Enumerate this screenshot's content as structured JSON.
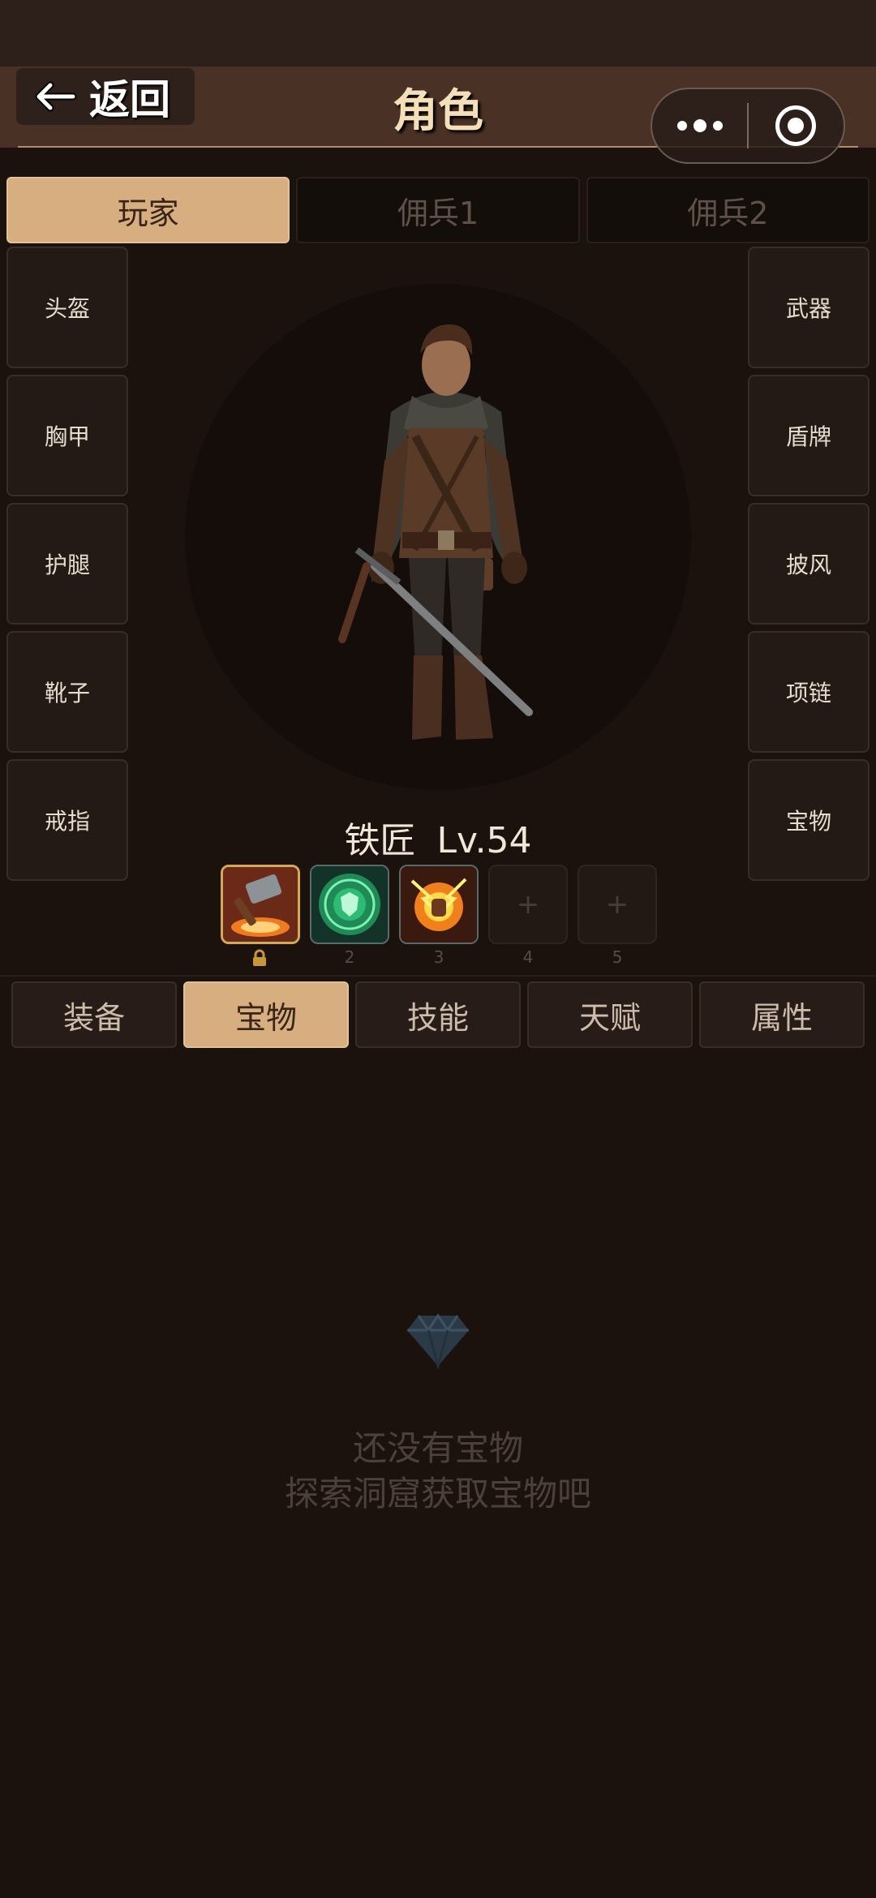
{
  "header": {
    "back_label": "返回",
    "title": "角色",
    "menu_icon": "more-dots-icon",
    "close_icon": "target-circle-icon"
  },
  "character_tabs": [
    {
      "label": "玩家",
      "active": true
    },
    {
      "label": "佣兵1",
      "active": false
    },
    {
      "label": "佣兵2",
      "active": false
    }
  ],
  "left_slots": [
    "头盔",
    "胸甲",
    "护腿",
    "靴子",
    "戒指"
  ],
  "right_slots": [
    "武器",
    "盾牌",
    "披风",
    "项链",
    "宝物"
  ],
  "hero": {
    "class_name": "铁匠",
    "level": "Lv.54"
  },
  "skills": [
    {
      "num": "",
      "icon": "hammer-fire-skill-icon",
      "locked": true
    },
    {
      "num": "2",
      "icon": "green-shield-rune-icon"
    },
    {
      "num": "3",
      "icon": "lightning-fist-icon"
    },
    {
      "num": "4",
      "icon": "plus-icon",
      "empty": true,
      "label": "+"
    },
    {
      "num": "5",
      "icon": "plus-icon",
      "empty": true,
      "label": "+"
    }
  ],
  "bottom_tabs": [
    {
      "label": "装备",
      "active": false
    },
    {
      "label": "宝物",
      "active": true
    },
    {
      "label": "技能",
      "active": false
    },
    {
      "label": "天赋",
      "active": false
    },
    {
      "label": "属性",
      "active": false
    }
  ],
  "empty_state": {
    "icon": "diamond-icon",
    "line1": "还没有宝物",
    "line2": "探索洞窟获取宝物吧"
  },
  "colors": {
    "accent": "#d6ae7f",
    "background": "#1b120e",
    "header": "#4a3126"
  }
}
